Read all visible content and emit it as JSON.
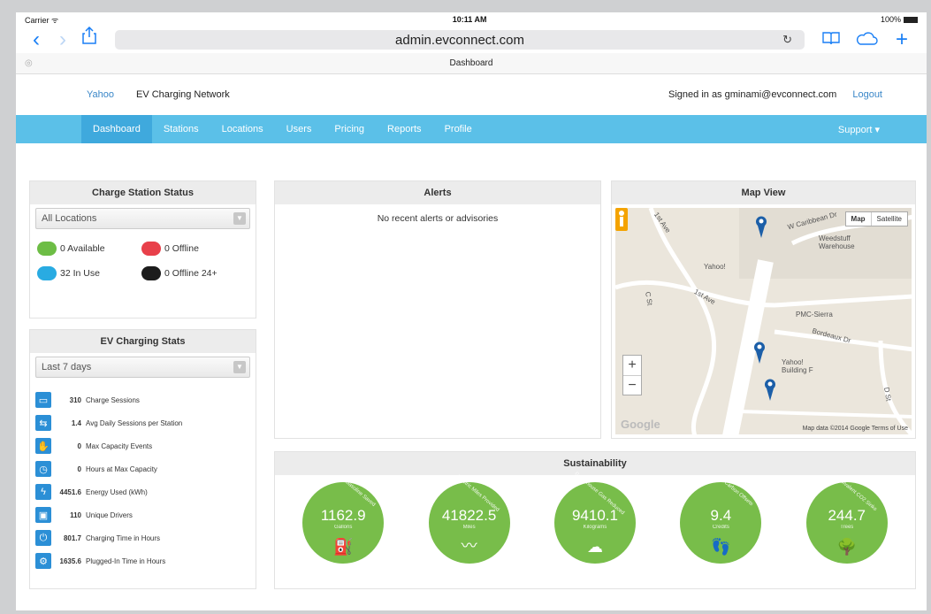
{
  "status_bar": {
    "carrier": "Carrier ᯤ",
    "time": "10:11 AM",
    "battery": "100%"
  },
  "browser": {
    "url": "admin.evconnect.com",
    "tab_title": "Dashboard"
  },
  "site_header": {
    "yahoo_link": "Yahoo",
    "brand": "EV Charging Network",
    "signed_in": "Signed in as gminami@evconnect.com",
    "logout": "Logout"
  },
  "nav": {
    "items": [
      "Dashboard",
      "Stations",
      "Locations",
      "Users",
      "Pricing",
      "Reports",
      "Profile"
    ],
    "active": "Dashboard",
    "support": "Support ▾"
  },
  "station_status": {
    "title": "Charge Station Status",
    "select": "All Locations",
    "items": [
      {
        "label": "0 Available",
        "color": "#6dbd45"
      },
      {
        "label": "0 Offline",
        "color": "#e8404a"
      },
      {
        "label": "32 In Use",
        "color": "#29abe2"
      },
      {
        "label": "0 Offline 24+",
        "color": "#1c1c1c"
      }
    ]
  },
  "ev_stats": {
    "title": "EV Charging Stats",
    "select": "Last 7 days",
    "rows": [
      {
        "icon": "car-icon",
        "value": "310",
        "label": "Charge Sessions"
      },
      {
        "icon": "station-icon",
        "value": "1.4",
        "label": "Avg Daily Sessions per Station"
      },
      {
        "icon": "hand-icon",
        "value": "0",
        "label": "Max Capacity Events"
      },
      {
        "icon": "clock-icon",
        "value": "0",
        "label": "Hours at Max Capacity"
      },
      {
        "icon": "bolt-icon",
        "value": "4451.6",
        "label": "Energy Used (kWh)"
      },
      {
        "icon": "driver-icon",
        "value": "110",
        "label": "Unique Drivers"
      },
      {
        "icon": "plug-icon",
        "value": "801.7",
        "label": "Charging Time in Hours"
      },
      {
        "icon": "plugged-icon",
        "value": "1635.6",
        "label": "Plugged-In Time in Hours"
      }
    ]
  },
  "alerts": {
    "title": "Alerts",
    "message": "No recent alerts or advisories"
  },
  "map": {
    "title": "Map View",
    "toggle_map": "Map",
    "toggle_satellite": "Satellite",
    "labels": {
      "first_ave_a": "1st Ave",
      "first_ave_b": "1st Ave",
      "w_caribbean": "W Caribbean Dr",
      "c_st": "C St",
      "weedstuff": "Weedstuff Warehouse",
      "yahoo": "Yahoo!",
      "pmc": "PMC-Sierra",
      "bordeaux": "Bordeaux Dr",
      "yahoo_f": "Yahoo! Building F",
      "d_st": "D St"
    },
    "footer": "Map data ©2014 Google   Terms of Use",
    "google": "Google"
  },
  "sustainability": {
    "title": "Sustainability",
    "items": [
      {
        "value": "1162.9",
        "unit": "Gallons",
        "arc": "Gasoline Saved",
        "symbol": "⛽"
      },
      {
        "value": "41822.5",
        "unit": "Miles",
        "arc": "Electric Miles Provided",
        "symbol": "〰"
      },
      {
        "value": "9410.1",
        "unit": "Kilograms",
        "arc": "Greenhouse Gas Reduced",
        "symbol": "☁"
      },
      {
        "value": "9.4",
        "unit": "Credits",
        "arc": "Carbon Offsets",
        "symbol": "👣"
      },
      {
        "value": "244.7",
        "unit": "Trees",
        "arc": "Equivalent CO2 Sinks",
        "symbol": "🌳"
      }
    ]
  }
}
